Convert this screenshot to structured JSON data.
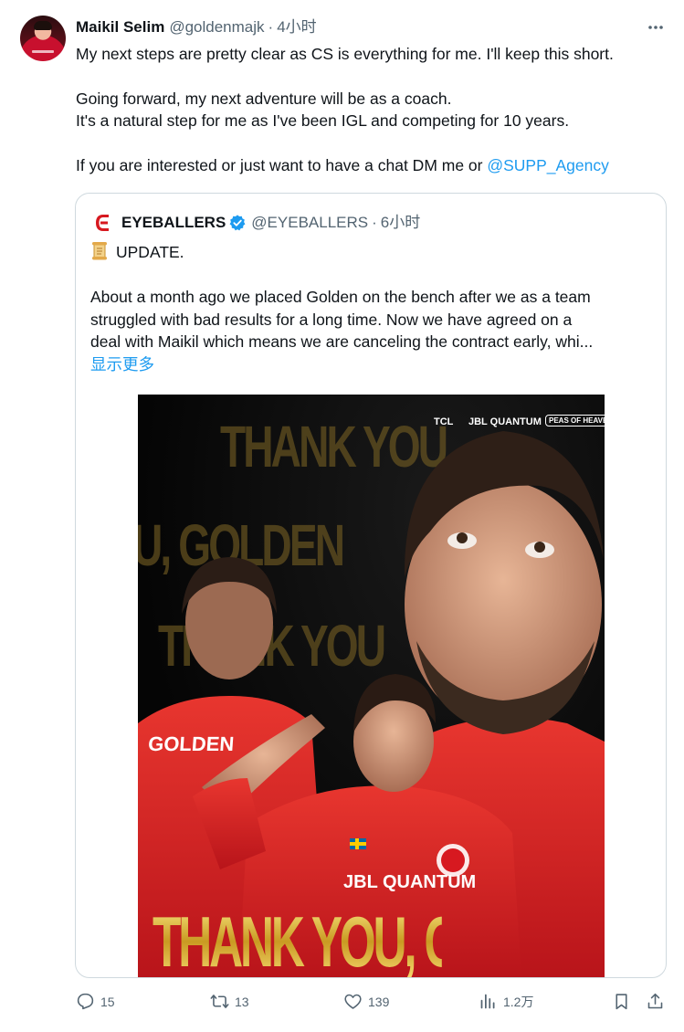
{
  "author": {
    "name": "Maikil Selim",
    "handle": "@goldenmajk",
    "separator": "·",
    "time": "4小时"
  },
  "tweet": {
    "lines": [
      "My next steps are pretty clear as CS is everything for me. I'll keep this short.",
      "Going forward, my next adventure will be as a coach.",
      "It's a natural step for me as I've been IGL and competing for 10 years.",
      "If you are interested or just want to have a chat DM me or "
    ],
    "mention": "@SUPP_Agency"
  },
  "quote": {
    "name": "EYEBALLERS",
    "handle": "@EYEBALLERS",
    "separator": "·",
    "time": "6小时",
    "update": "UPDATE.",
    "lines": [
      "About a month ago we placed Golden on the bench after we as a team",
      "struggled with bad results for a long time. Now we have agreed on a",
      "deal with Maikil which means we are canceling the contract early, whi..."
    ],
    "show_more": "显示更多",
    "media": {
      "brand_1": "TCL",
      "brand_2": "JBL QUANTUM",
      "brand_3": "PEAS OF HEAVEN",
      "bg_line_1": "THANK YOU",
      "bg_line_2": "U, GOLDEN",
      "bg_line_3": "THANK YOU",
      "jersey": "GOLDEN",
      "headline": "THANK YOU, GOLDEN"
    }
  },
  "actions": {
    "replies": "15",
    "retweets": "13",
    "likes": "139",
    "views": "1.2万"
  },
  "colors": {
    "link": "#1d9bf0",
    "muted": "#536471",
    "text": "#0f1419",
    "brand_red": "#d71920",
    "gold": "#d9b43a"
  }
}
